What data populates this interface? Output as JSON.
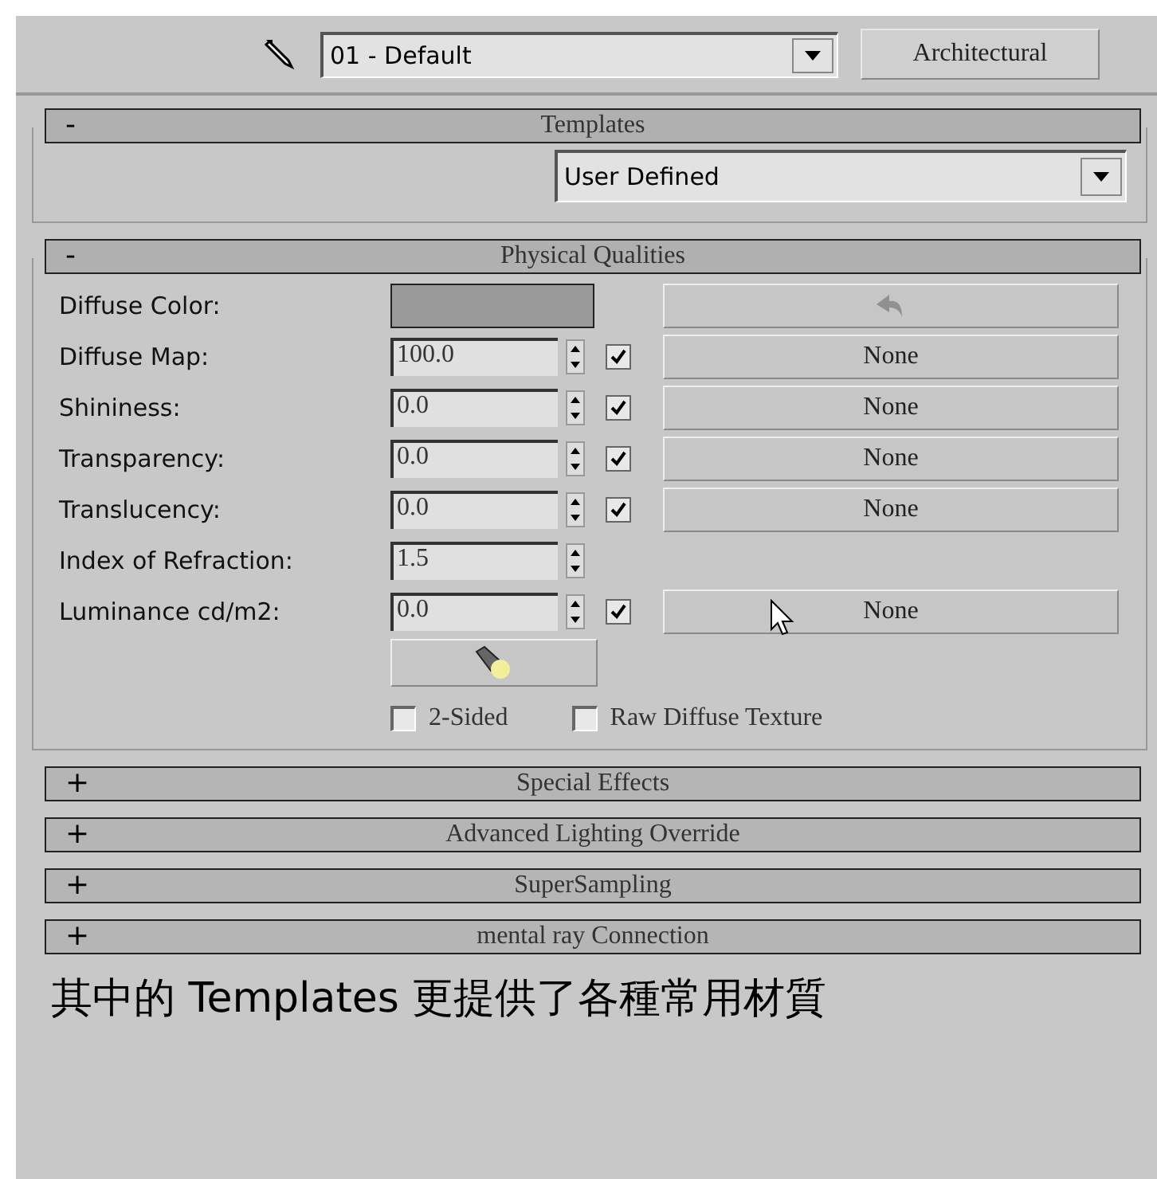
{
  "toolbar": {
    "material_name": "01 - Default",
    "type_button": "Architectural"
  },
  "templates": {
    "title": "Templates",
    "sign": "-",
    "dropdown": "User Defined"
  },
  "physical": {
    "title": "Physical Qualities",
    "sign": "-",
    "rows": [
      {
        "kind": "color",
        "label": "Diffuse Color:",
        "color": "#9a9a9a"
      },
      {
        "kind": "spinner_map",
        "label": "Diffuse Map:",
        "value": "100.0",
        "checked": true,
        "map": "None"
      },
      {
        "kind": "spinner_map",
        "label": "Shininess:",
        "value": "0.0",
        "checked": true,
        "map": "None"
      },
      {
        "kind": "spinner_map",
        "label": "Transparency:",
        "value": "0.0",
        "checked": true,
        "map": "None"
      },
      {
        "kind": "spinner_map",
        "label": "Translucency:",
        "value": "0.0",
        "checked": true,
        "map": "None"
      },
      {
        "kind": "spinner",
        "label": "Index of Refraction:",
        "value": "1.5"
      },
      {
        "kind": "spinner_map",
        "label": "Luminance cd/m2:",
        "value": "0.0",
        "checked": true,
        "map": "None"
      }
    ],
    "options": [
      {
        "label": "2-Sided",
        "checked": false
      },
      {
        "label": "Raw Diffuse Texture",
        "checked": false
      }
    ]
  },
  "collapsed_rollouts": [
    {
      "sign": "+",
      "title": "Special Effects"
    },
    {
      "sign": "+",
      "title": "Advanced Lighting Override"
    },
    {
      "sign": "+",
      "title": "SuperSampling"
    },
    {
      "sign": "+",
      "title": "mental ray Connection"
    }
  ],
  "caption": "其中的 Templates 更提供了各種常用材質"
}
